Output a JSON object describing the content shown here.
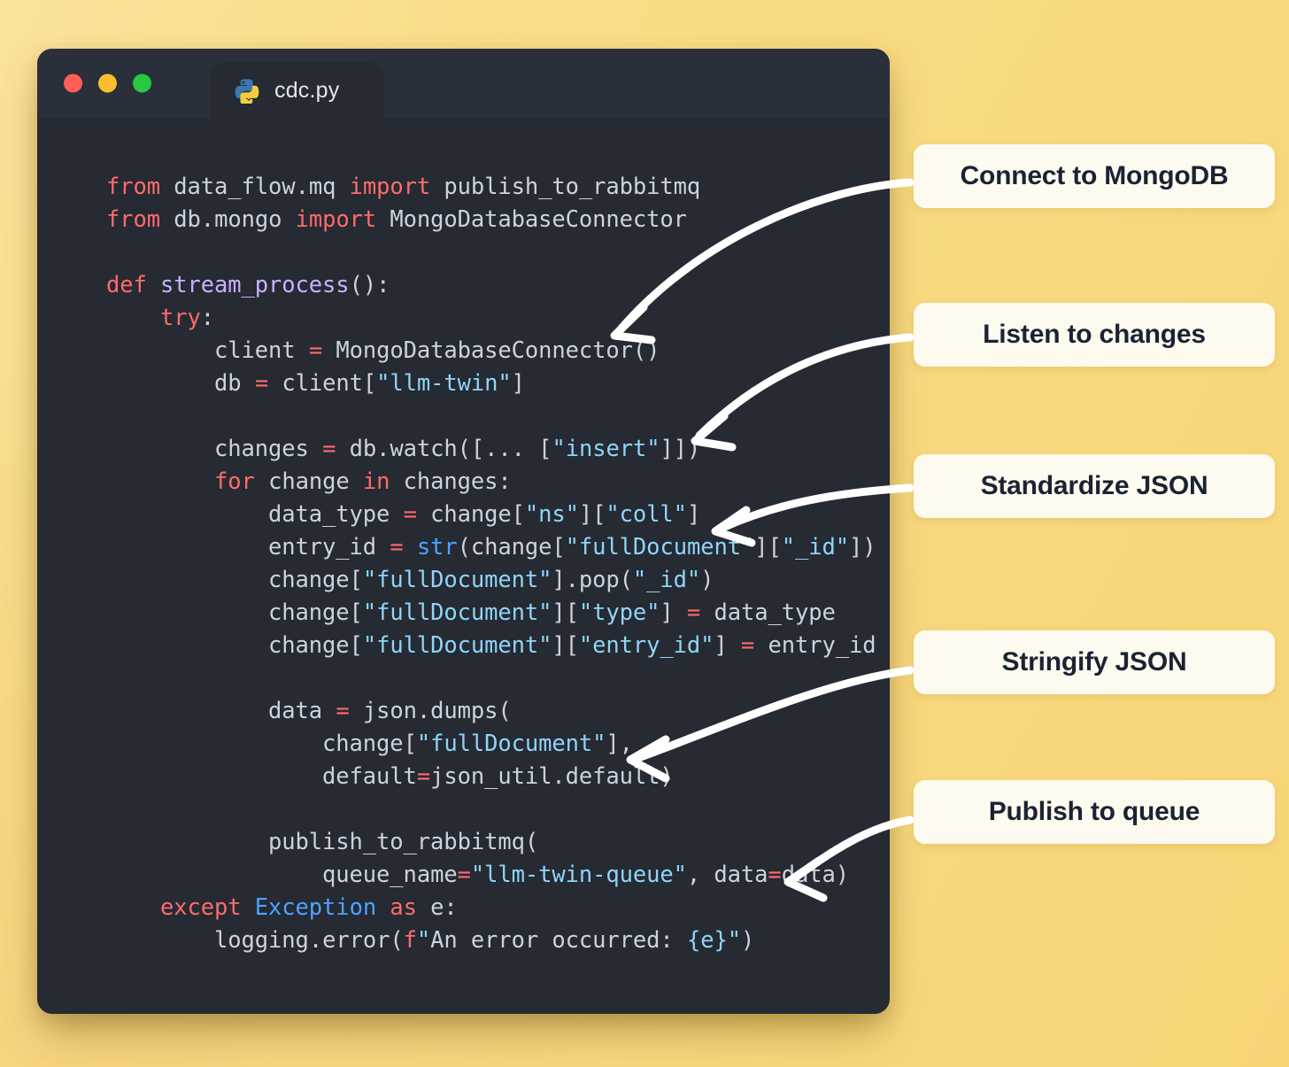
{
  "window": {
    "traffic_lights": [
      {
        "name": "close",
        "color": "#ff5f57"
      },
      {
        "name": "minimize",
        "color": "#f9bd2e"
      },
      {
        "name": "maximize",
        "color": "#28c840"
      }
    ],
    "tab": {
      "icon": "python-icon",
      "filename": "cdc.py"
    },
    "background": "#252a33",
    "titlebar_background": "#2a303a"
  },
  "theme": {
    "page_background": "#f9da81",
    "label_background": "#fdfaef",
    "label_text": "#1b2233",
    "arrow_color": "#ffffff",
    "code_default": "#cdd3dc",
    "keyword": "#ff6b6b",
    "function": "#c8b0ff",
    "string": "#8fd4f7",
    "builtin": "#4da3ff",
    "kwarg": "#f5a03c"
  },
  "code": {
    "language": "python",
    "lines": [
      "from data_flow.mq import publish_to_rabbitmq",
      "from db.mongo import MongoDatabaseConnector",
      "",
      "def stream_process():",
      "    try:",
      "        client = MongoDatabaseConnector()",
      "        db = client[\"llm-twin\"]",
      "",
      "        changes = db.watch([... [\"insert\"]])",
      "        for change in changes:",
      "            data_type = change[\"ns\"][\"coll\"]",
      "            entry_id = str(change[\"fullDocument\"][\"_id\"])",
      "            change[\"fullDocument\"].pop(\"_id\")",
      "            change[\"fullDocument\"][\"type\"] = data_type",
      "            change[\"fullDocument\"][\"entry_id\"] = entry_id",
      "",
      "            data = json.dumps(",
      "                change[\"fullDocument\"],",
      "                default=json_util.default)",
      "",
      "            publish_to_rabbitmq(",
      "                queue_name=\"llm-twin-queue\", data=data)",
      "    except Exception as e:",
      "        logging.error(f\"An error occurred: {e}\")"
    ]
  },
  "annotations": [
    {
      "label": "Connect to MongoDB",
      "target_line": "from db.mongo import MongoDatabaseConnector"
    },
    {
      "label": "Listen to changes",
      "target_line": "changes = db.watch([... [\"insert\"]])"
    },
    {
      "label": "Standardize JSON",
      "target_line": "data_type = change[\"ns\"][\"coll\"]"
    },
    {
      "label": "Stringify JSON",
      "target_line": "change[\"fullDocument\"],"
    },
    {
      "label": "Publish to queue",
      "target_line": "queue_name=\"llm-twin-queue\", data=data)"
    }
  ]
}
